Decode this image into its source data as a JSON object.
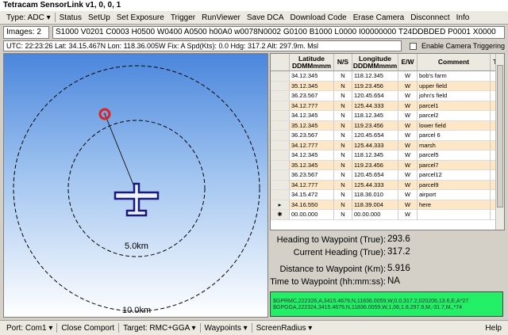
{
  "window": {
    "title": "Tetracam SensorLink v1, 0, 0, 1"
  },
  "menu": {
    "type": "Type: ADC ▾",
    "items": [
      "Status",
      "SetUp",
      "Set Exposure",
      "Trigger",
      "RunViewer",
      "Save DCA",
      "Download Code",
      "Erase Camera",
      "Disconnect",
      "Info"
    ]
  },
  "command": {
    "images_label": "Images: 2",
    "string": "S1000 V0201 C0003 H0500 W0400 A0500 h00A0 w0078N0002 G0100 B1000 L0000 I00000000 T24DDBDED P0001 X0000"
  },
  "status": {
    "line": "UTC: 22:23:26  Lat: 34.15.467N  Lon: 118.36.005W  Fix: A  Spd(Kts): 0.0  Hdg: 317.2  Alt: 297.9m. Msl",
    "camera_trigger_label": "Enable Camera Triggering"
  },
  "radar": {
    "inner_ring_label": "5.0km",
    "outer_ring_label": "10.0km",
    "heading_deg": 317.2,
    "waypoint_distance_km": 5.916
  },
  "waypoints": {
    "headers": [
      "Latitude DDMMmmm",
      "N/S",
      "Longitude DDDMMmmm",
      "E/W",
      "Comment",
      "T"
    ],
    "rows": [
      {
        "ind": "",
        "lat": "34.12.345",
        "ns": "N",
        "lon": "118.12.345",
        "ew": "W",
        "comment": "bob's farm"
      },
      {
        "ind": "",
        "lat": "35.12.345",
        "ns": "N",
        "lon": "119.23.456",
        "ew": "W",
        "comment": "upper field"
      },
      {
        "ind": "",
        "lat": "36.23.567",
        "ns": "N",
        "lon": "120.45.654",
        "ew": "W",
        "comment": "john's field"
      },
      {
        "ind": "",
        "lat": "34.12.777",
        "ns": "N",
        "lon": "125.44.333",
        "ew": "W",
        "comment": "parcel1"
      },
      {
        "ind": "",
        "lat": "34.12.345",
        "ns": "N",
        "lon": "118.12.345",
        "ew": "W",
        "comment": "parcel2"
      },
      {
        "ind": "",
        "lat": "35.12.345",
        "ns": "N",
        "lon": "119.23.456",
        "ew": "W",
        "comment": "lower field"
      },
      {
        "ind": "",
        "lat": "36.23.567",
        "ns": "N",
        "lon": "120.45.654",
        "ew": "W",
        "comment": "parcel 6"
      },
      {
        "ind": "",
        "lat": "34.12.777",
        "ns": "N",
        "lon": "125.44.333",
        "ew": "W",
        "comment": "marsh"
      },
      {
        "ind": "",
        "lat": "34.12.345",
        "ns": "N",
        "lon": "118.12.345",
        "ew": "W",
        "comment": "parcel5"
      },
      {
        "ind": "",
        "lat": "35.12.345",
        "ns": "N",
        "lon": "119.23.456",
        "ew": "W",
        "comment": "parcel7"
      },
      {
        "ind": "",
        "lat": "36.23.567",
        "ns": "N",
        "lon": "120.45.654",
        "ew": "W",
        "comment": "parcel12"
      },
      {
        "ind": "",
        "lat": "34.12.777",
        "ns": "N",
        "lon": "125.44.333",
        "ew": "W",
        "comment": "parcel9"
      },
      {
        "ind": "",
        "lat": "34.15.472",
        "ns": "N",
        "lon": "118.36.010",
        "ew": "W",
        "comment": "airport"
      },
      {
        "ind": "▸",
        "lat": "34.16.550",
        "ns": "N",
        "lon": "118.39.004",
        "ew": "W",
        "comment": "here"
      },
      {
        "ind": "✱",
        "lat": "00.00.000",
        "ns": "N",
        "lon": "00.00.000",
        "ew": "W",
        "comment": ""
      }
    ]
  },
  "nav": {
    "heading_to_wp_label": "Heading to Waypoint (True):",
    "heading_to_wp_value": "293.6",
    "current_heading_label": "Current Heading (True):",
    "current_heading_value": "317.2",
    "distance_label": "Distance to Waypoint (Km):",
    "distance_value": "5.916",
    "time_label": "Time to Waypoint (hh:mm:ss):",
    "time_value": "NA"
  },
  "nmea": {
    "line1": "$GPRMC,222326,A,3415.4679,N,11836.0059,W,0.0,317.2,020206,13.6,E,A*27",
    "line2": "$GPGGA,222324,3415.4679,N,11836.0059,W,1,06,1.8,297.9,M,-31.7,M,,*74"
  },
  "bottom": {
    "port": "Port: Com1 ▾",
    "close": "Close Comport",
    "target": "Target: RMC+GGA ▾",
    "waypoints": "Waypoints ▾",
    "radius": "ScreenRadius ▾",
    "help": "Help"
  },
  "colors": {
    "aircraft": "#1a1a7a",
    "waypoint_marker": "#dd2222",
    "nmea_bg": "#22ee66",
    "row_alt": "#fde7c6"
  }
}
